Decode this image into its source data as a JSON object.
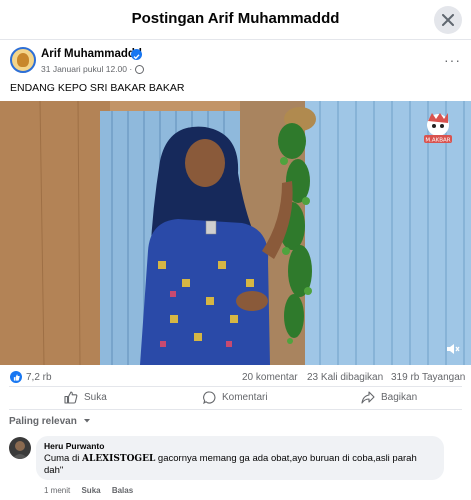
{
  "dialog": {
    "title": "Postingan Arif Muhammaddd"
  },
  "post": {
    "author": "Arif Muhammaddd",
    "timestamp": "31 Januari pukul 12.00",
    "dot": "·",
    "caption": "ENDANG KEPO SRI BAKAR BAKAR",
    "more_label": "···"
  },
  "stats": {
    "likes": "7,2 rb",
    "comments": "20 komentar",
    "shares": "23 Kali dibagikan",
    "views": "319 rb Tayangan"
  },
  "actions": {
    "like": "Suka",
    "comment": "Komentari",
    "share": "Bagikan"
  },
  "comments_section": {
    "sort_label": "Paling relevan",
    "comments": [
      {
        "author": "Heru Purwanto",
        "text_prefix": "Cuma di ",
        "text_bold": "ALEXISTOGEL",
        "text_suffix": " gacornya memang ga ada obat,ayo buruan di coba,asli parah dah\"",
        "time": "1 menit",
        "like_label": "Suka",
        "reply_label": "Balas"
      }
    ]
  },
  "icons": {
    "close": "close-icon",
    "verified": "verified-badge-icon",
    "globe": "globe-icon",
    "like_badge": "like-reaction-icon",
    "volume": "volume-icon"
  },
  "colors": {
    "accent": "#1877f2",
    "secondary_text": "#65676b",
    "bubble": "#f0f2f5"
  }
}
